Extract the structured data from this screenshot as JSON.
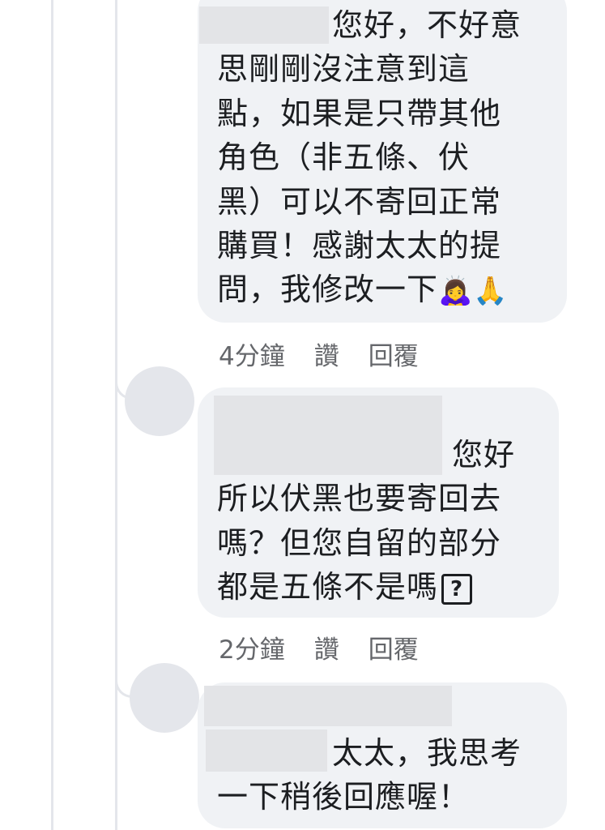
{
  "comments": [
    {
      "lines": [
        "您好，不好意",
        "思剛剛沒注意到這",
        "點，如果是只帶其他",
        "角色（非五條、伏",
        "黑）可以不寄回正常",
        "購買！感謝太太的提",
        "問，我修改一下"
      ],
      "emoji": "🙇‍♀️🙏",
      "time": "4分鐘",
      "like_label": "讚",
      "reply_label": "回覆"
    },
    {
      "lines": [
        "您好",
        "所以伏黑也要寄回去",
        "嗎？但您自留的部分",
        "都是五條不是嗎"
      ],
      "emoji": "?",
      "time": "2分鐘",
      "like_label": "讚",
      "reply_label": "回覆"
    },
    {
      "lines": [
        "太太，我思考",
        "一下稍後回應喔！"
      ]
    }
  ]
}
